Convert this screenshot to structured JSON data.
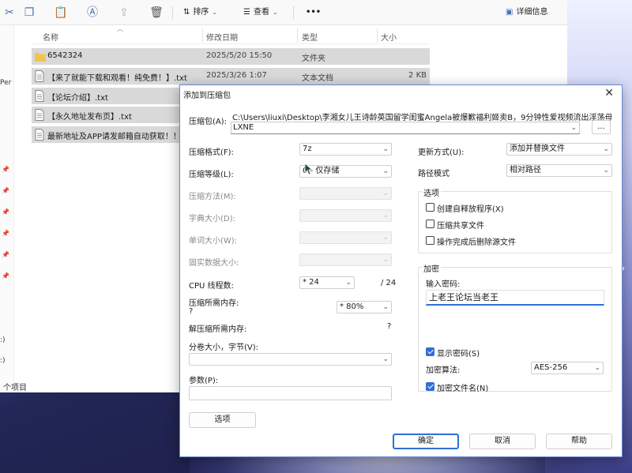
{
  "explorer": {
    "toolbar": {
      "sort_label": "排序",
      "view_label": "查看",
      "more_label": "•••",
      "details_label": "详细信息"
    },
    "nav": {
      "left_text_1": "Per",
      "left_text_2": ":)",
      "left_text_3": ":)"
    },
    "columns": [
      "名称",
      "修改日期",
      "类型",
      "大小"
    ],
    "files": [
      {
        "name": "6542324",
        "date": "2025/5/20 15:50",
        "type": "文件夹",
        "size": "",
        "icon": "folder-icon"
      },
      {
        "name": "【来了就能下载和观看！纯免费！】.txt",
        "date": "2025/3/26 1:07",
        "type": "文本文档",
        "size": "2 KB",
        "icon": "text-file-icon"
      },
      {
        "name": "【论坛介绍】.txt",
        "date": "",
        "type": "",
        "size": "",
        "icon": "text-file-icon"
      },
      {
        "name": "【永久地址发布页】.txt",
        "date": "",
        "type": "",
        "size": "",
        "icon": "text-file-icon"
      },
      {
        "name": "最新地址及APP请发邮箱自动获取！！",
        "date": "",
        "type": "",
        "size": "",
        "icon": "text-file-icon"
      }
    ],
    "status": "个项目"
  },
  "dialog": {
    "title": "添加到压缩包",
    "close": "✕",
    "archive_label": "压缩包(A):",
    "archive_path": "C:\\Users\\liuxi\\Desktop\\李湘女儿王诗龄英国留学闺蜜Angela被爆歉福利姬卖B，9分钟性爱视频流出淫荡母狗床",
    "archive_path_line2": "LXNE",
    "browse": "...",
    "format_label": "压缩格式(F):",
    "format_value": "7z",
    "level_label": "压缩等级(L):",
    "level_value": "0 - 仅存储",
    "method_label": "压缩方法(M):",
    "dict_label": "字典大小(D):",
    "word_label": "单词大小(W):",
    "solid_label": "固实数据大小:",
    "threads_label": "CPU 线程数:",
    "threads_value": "* 24",
    "threads_max": "/ 24",
    "mem_comp_label": "压缩所需内存:",
    "mem_comp_q": "?",
    "mem_comp_value": "* 80%",
    "mem_decomp_label": "解压缩所需内存:",
    "mem_decomp_q": "?",
    "split_label": "分卷大小，字节(V):",
    "params_label": "参数(P):",
    "options_button": "选项",
    "update_label": "更新方式(U):",
    "update_value": "添加并替换文件",
    "path_mode_label": "路径模式",
    "path_mode_value": "相对路径",
    "options_group": "选项",
    "opt_sfx": "创建自释放程序(X)",
    "opt_shared": "压缩共享文件",
    "opt_delete": "操作完成后删除源文件",
    "encrypt_group": "加密",
    "password_label": "输入密码:",
    "password_value": "上老王论坛当老王",
    "show_password": "显示密码(S)",
    "encrypt_method_label": "加密算法:",
    "encrypt_method_value": "AES-256",
    "encrypt_names": "加密文件名(N)",
    "ok": "确定",
    "cancel": "取消",
    "help": "帮助"
  },
  "colors": {
    "accent": "#2f6fd6",
    "row_selected": "#d9d9d9",
    "folder": "#f2c44e"
  }
}
